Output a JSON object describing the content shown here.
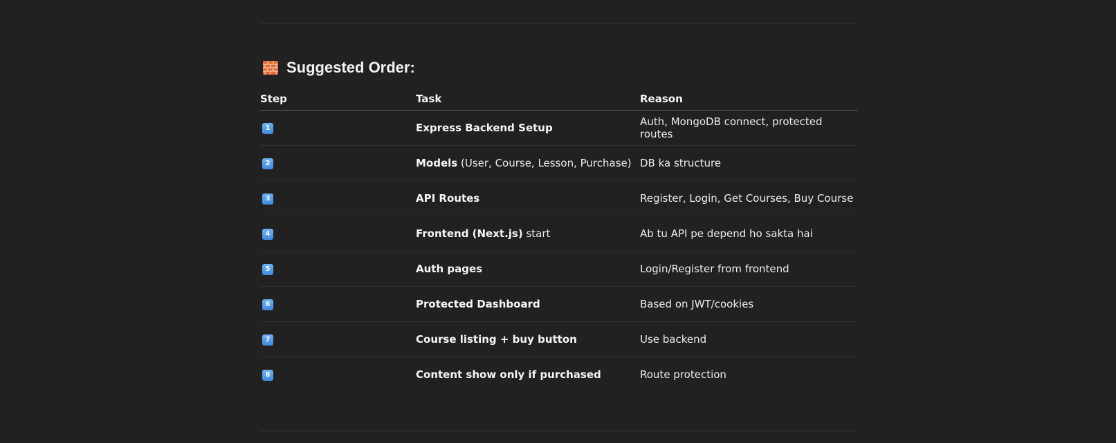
{
  "section": {
    "heading_icon": "brick-icon",
    "heading": "Suggested Order:"
  },
  "table": {
    "headers": {
      "step": "Step",
      "task": "Task",
      "reason": "Reason"
    },
    "rows": [
      {
        "step": "1",
        "step_icon": "keycap-1-icon",
        "task_bold": "Express Backend Setup",
        "task_rest": "",
        "reason": "Auth, MongoDB connect, protected routes"
      },
      {
        "step": "2",
        "step_icon": "keycap-2-icon",
        "task_bold": "Models",
        "task_rest": " (User, Course, Lesson, Purchase)",
        "reason": "DB ka structure"
      },
      {
        "step": "3",
        "step_icon": "keycap-3-icon",
        "task_bold": "API Routes",
        "task_rest": "",
        "reason": "Register, Login, Get Courses, Buy Course"
      },
      {
        "step": "4",
        "step_icon": "keycap-4-icon",
        "task_bold": "Frontend (Next.js)",
        "task_rest": " start",
        "reason": "Ab tu API pe depend ho sakta hai"
      },
      {
        "step": "5",
        "step_icon": "keycap-5-icon",
        "task_bold": "Auth pages",
        "task_rest": "",
        "reason": "Login/Register from frontend"
      },
      {
        "step": "6",
        "step_icon": "keycap-6-icon",
        "task_bold": "Protected Dashboard",
        "task_rest": "",
        "reason": "Based on JWT/cookies"
      },
      {
        "step": "7",
        "step_icon": "keycap-7-icon",
        "task_bold": "Course listing + buy button",
        "task_rest": "",
        "reason": "Use backend"
      },
      {
        "step": "8",
        "step_icon": "keycap-8-icon",
        "task_bold": "Content show only if purchased",
        "task_rest": "",
        "reason": "Route protection"
      }
    ]
  },
  "colors": {
    "background": "#212121",
    "text": "#ececec",
    "keycap": "#4a90e2",
    "brick": "#e06a3b"
  }
}
